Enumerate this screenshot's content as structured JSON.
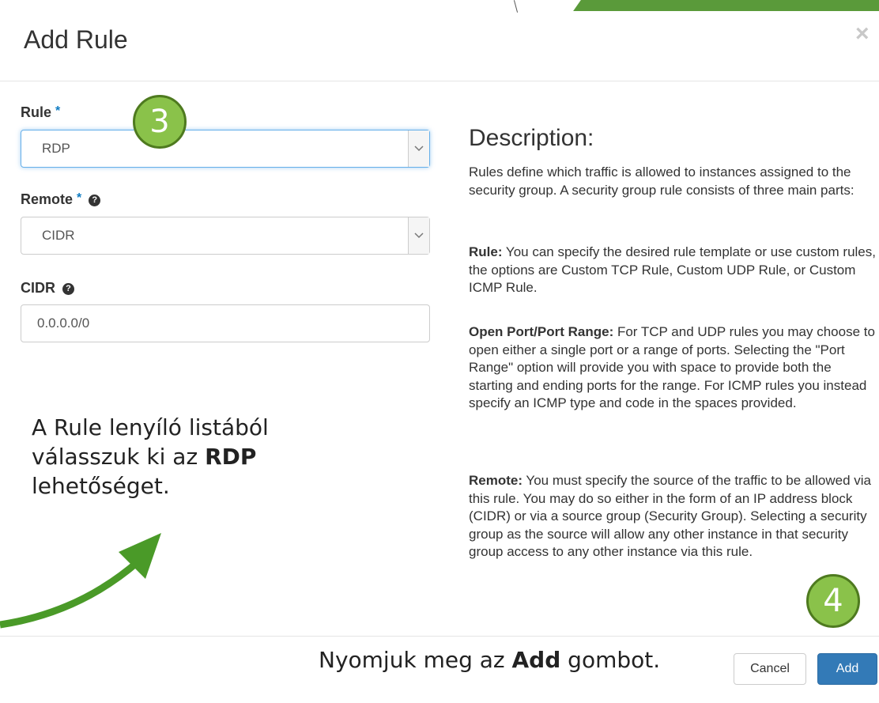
{
  "dialog": {
    "title": "Add Rule",
    "close_symbol": "×"
  },
  "form": {
    "rule_label": "Rule",
    "rule_value": "RDP",
    "remote_label": "Remote",
    "remote_value": "CIDR",
    "cidr_label": "CIDR",
    "cidr_value": "0.0.0.0/0",
    "required_mark": "*",
    "help_symbol": "?"
  },
  "description": {
    "heading": "Description:",
    "intro": "Rules define which traffic is allowed to instances assigned to the security group. A security group rule consists of three main parts:",
    "rule_term": "Rule:",
    "rule_text": " You can specify the desired rule template or use custom rules, the options are Custom TCP Rule, Custom UDP Rule, or Custom ICMP Rule.",
    "port_term": "Open Port/Port Range:",
    "port_text": " For TCP and UDP rules you may choose to open either a single port or a range of ports. Selecting the \"Port Range\" option will provide you with space to provide both the starting and ending ports for the range. For ICMP rules you instead specify an ICMP type and code in the spaces provided.",
    "remote_term": "Remote:",
    "remote_text": " You must specify the source of the traffic to be allowed via this rule. You may do so either in the form of an IP address block (CIDR) or via a source group (Security Group). Selecting a security group as the source will allow any other instance in that security group access to any other instance via this rule."
  },
  "annotations": {
    "note_part1": "A Rule lenyíló listából válasszuk ki az ",
    "note_bold": "RDP",
    "note_part2": " lehetőséget.",
    "bottom_part1": "Nyomjuk meg az ",
    "bottom_bold": "Add",
    "bottom_part2": " gombot.",
    "badge3": "3",
    "badge4": "4"
  },
  "buttons": {
    "cancel": "Cancel",
    "add": "Add"
  },
  "colors": {
    "accent": "#337ab7",
    "required": "#0e7bc2",
    "badge_green": "#8ac24a",
    "arrow_green": "#4a9a28"
  },
  "icons": {
    "close": "close-icon",
    "caret": "chevron-down-icon",
    "help": "help-icon",
    "arrow": "arrow-icon"
  }
}
